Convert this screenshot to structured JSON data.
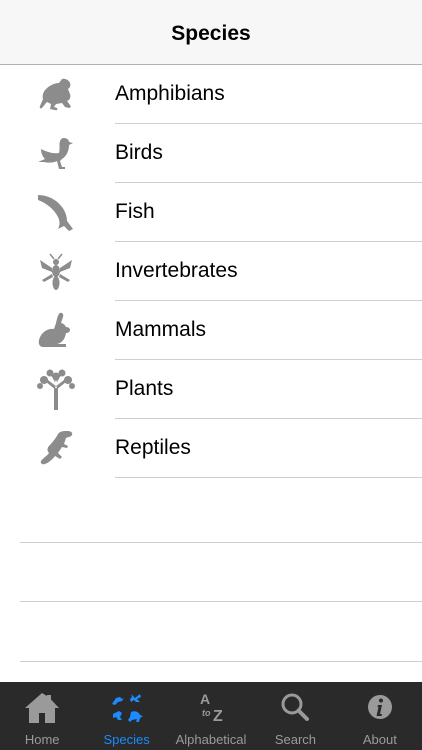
{
  "navbar": {
    "title": "Species"
  },
  "species": [
    {
      "label": "Amphibians",
      "icon": "frog-icon"
    },
    {
      "label": "Birds",
      "icon": "bird-icon"
    },
    {
      "label": "Fish",
      "icon": "fish-icon"
    },
    {
      "label": "Invertebrates",
      "icon": "insect-icon"
    },
    {
      "label": "Mammals",
      "icon": "rabbit-icon"
    },
    {
      "label": "Plants",
      "icon": "tree-icon"
    },
    {
      "label": "Reptiles",
      "icon": "lizard-icon"
    }
  ],
  "tabbar": {
    "active": "Species",
    "items": [
      {
        "label": "Home",
        "icon": "home-icon"
      },
      {
        "label": "Species",
        "icon": "species-icon"
      },
      {
        "label": "Alphabetical",
        "icon": "a-to-z-icon"
      },
      {
        "label": "Search",
        "icon": "search-icon"
      },
      {
        "label": "About",
        "icon": "info-icon"
      }
    ]
  },
  "colors": {
    "icon_gray": "#8c8c8c",
    "tab_inactive": "#9a9a9a",
    "tab_active": "#1a8cff",
    "tabbar_bg": "#2a2a2a"
  }
}
